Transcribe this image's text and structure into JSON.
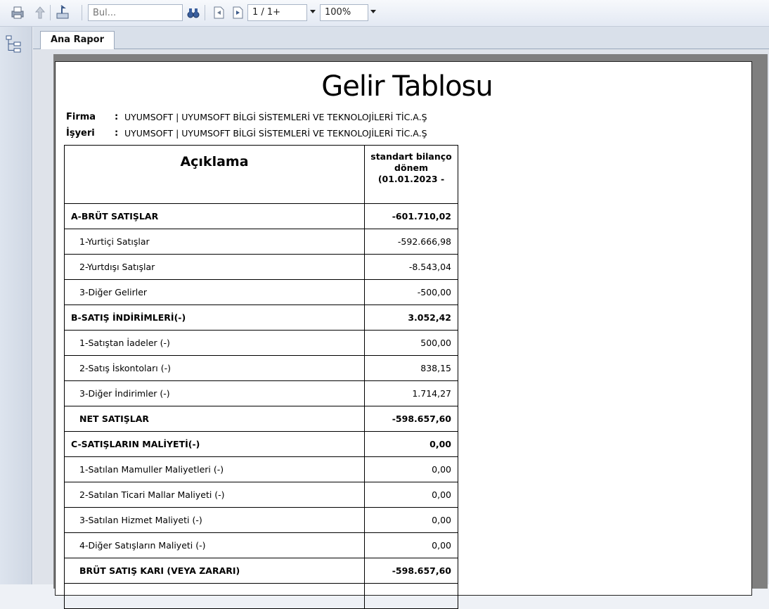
{
  "toolbar": {
    "search_placeholder": "Bul...",
    "page_value": "1 / 1+",
    "zoom_value": "100%"
  },
  "tab": {
    "label": "Ana Rapor"
  },
  "report": {
    "title": "Gelir Tablosu",
    "meta": [
      {
        "label": "Firma",
        "value": "UYUMSOFT | UYUMSOFT BİLGİ SİSTEMLERİ VE TEKNOLOJİLERİ TİC.A.Ş"
      },
      {
        "label": "İşyeri",
        "value": "UYUMSOFT | UYUMSOFT BİLGİ SİSTEMLERİ VE TEKNOLOJİLERİ TİC.A.Ş"
      }
    ],
    "table": {
      "header_desc": "Açıklama",
      "header_col_line1": "standart bilanço",
      "header_col_line2": "dönem",
      "header_col_line3": "(01.01.2023 -",
      "rows": [
        {
          "label": "A-BRÜT SATIŞLAR",
          "value": "-601.710,02"
        },
        {
          "label": "1-Yurtiçi Satışlar",
          "value": "-592.666,98"
        },
        {
          "label": "2-Yurtdışı Satışlar",
          "value": "-8.543,04"
        },
        {
          "label": "3-Diğer Gelirler",
          "value": "-500,00"
        },
        {
          "label": "B-SATIŞ İNDİRİMLERİ(-)",
          "value": "3.052,42"
        },
        {
          "label": "1-Satıştan İadeler (-)",
          "value": "500,00"
        },
        {
          "label": "2-Satış İskontoları (-)",
          "value": "838,15"
        },
        {
          "label": "3-Diğer İndirimler (-)",
          "value": "1.714,27"
        },
        {
          "label": "NET SATIŞLAR",
          "value": "-598.657,60"
        },
        {
          "label": "C-SATIŞLARIN MALİYETİ(-)",
          "value": "0,00"
        },
        {
          "label": "1-Satılan Mamuller Maliyetleri (-)",
          "value": "0,00"
        },
        {
          "label": "2-Satılan Ticari Mallar Maliyeti (-)",
          "value": "0,00"
        },
        {
          "label": "3-Satılan Hizmet Maliyeti (-)",
          "value": "0,00"
        },
        {
          "label": "4-Diğer Satışların Maliyeti (-)",
          "value": "0,00"
        },
        {
          "label": "BRÜT SATIŞ KARI (VEYA ZARARI)",
          "value": "-598.657,60"
        },
        {
          "label": "",
          "value": ""
        }
      ]
    }
  },
  "icons": {
    "print": "printer-icon",
    "up": "up-arrow-icon",
    "export": "export-icon",
    "find": "binoculars-icon",
    "prev_page": "previous-page-icon",
    "next_page": "next-page-icon",
    "tree": "document-tree-icon"
  }
}
